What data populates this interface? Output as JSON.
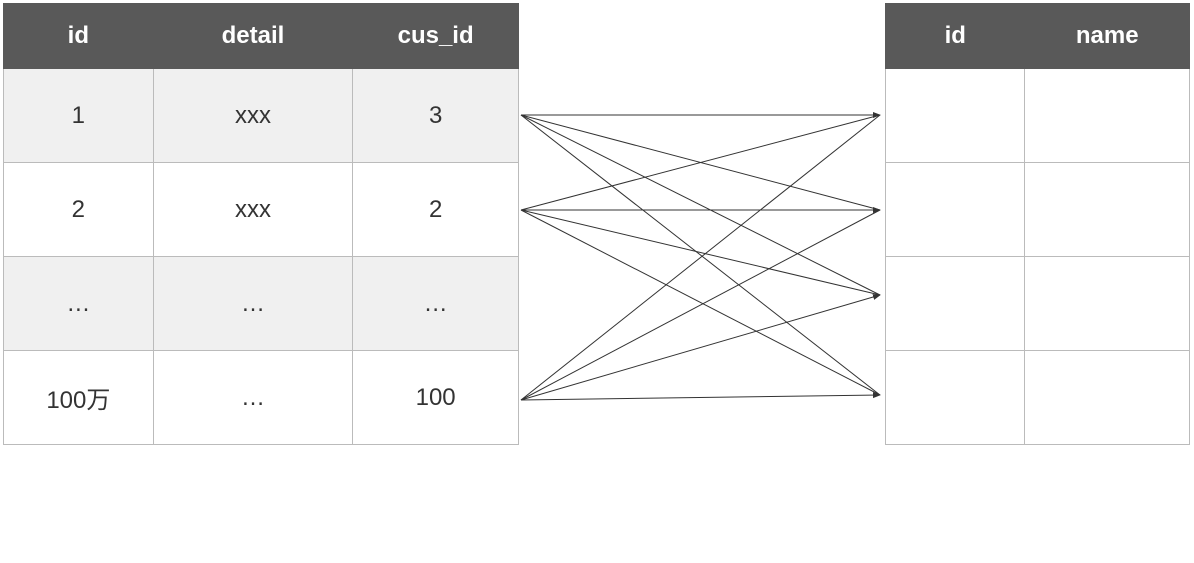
{
  "left_table": {
    "headers": [
      "id",
      "detail",
      "cus_id"
    ],
    "rows": [
      {
        "id": "1",
        "detail": "xxx",
        "cus_id": "3"
      },
      {
        "id": "2",
        "detail": "xxx",
        "cus_id": "2"
      },
      {
        "id": "…",
        "detail": "…",
        "cus_id": "…"
      },
      {
        "id": "100万",
        "detail": "…",
        "cus_id": "100"
      }
    ]
  },
  "right_table": {
    "headers": [
      "id",
      "name"
    ],
    "rows": [
      {
        "id": "",
        "name": ""
      },
      {
        "id": "",
        "name": ""
      },
      {
        "id": "",
        "name": ""
      },
      {
        "id": "",
        "name": ""
      }
    ]
  },
  "connections": {
    "description": "Many-to-many lines connecting left table rows to right table rows",
    "left_anchors": 4,
    "right_anchors": 4
  }
}
